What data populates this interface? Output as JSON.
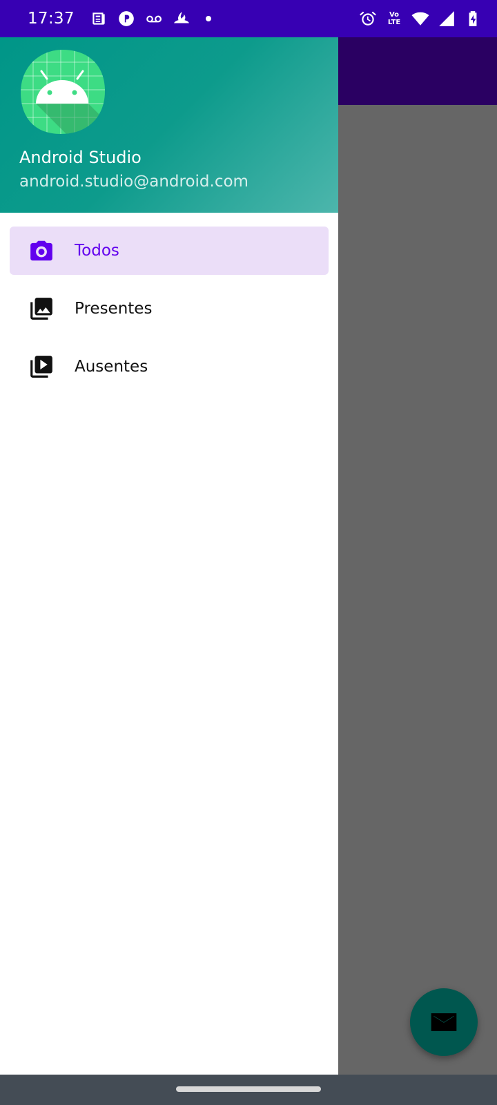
{
  "status_bar": {
    "time": "17:37",
    "left_icons": [
      "news-icon",
      "app-p-icon",
      "voicemail-icon",
      "santander-icon",
      "notification-dot"
    ],
    "right_icons": [
      "alarm-icon",
      "volte-icon",
      "wifi-icon",
      "signal-icon",
      "battery-charging-icon"
    ],
    "volte_line1": "Vo",
    "volte_line2": "LTE"
  },
  "drawer": {
    "header": {
      "name": "Android Studio",
      "email": "android.studio@android.com",
      "avatar_icon": "android-logo-icon"
    },
    "items": [
      {
        "label": "Todos",
        "icon": "camera-icon",
        "selected": true
      },
      {
        "label": "Presentes",
        "icon": "photo-library-icon",
        "selected": false
      },
      {
        "label": "Ausentes",
        "icon": "video-library-icon",
        "selected": false
      }
    ]
  },
  "fab": {
    "icon": "mail-icon"
  },
  "colors": {
    "status_bar": "#3700b3",
    "toolbar": "#2a0062",
    "header_start": "#009688",
    "accent": "#6200ee",
    "selected_bg": "#ebdef8",
    "fab": "#00574f"
  }
}
